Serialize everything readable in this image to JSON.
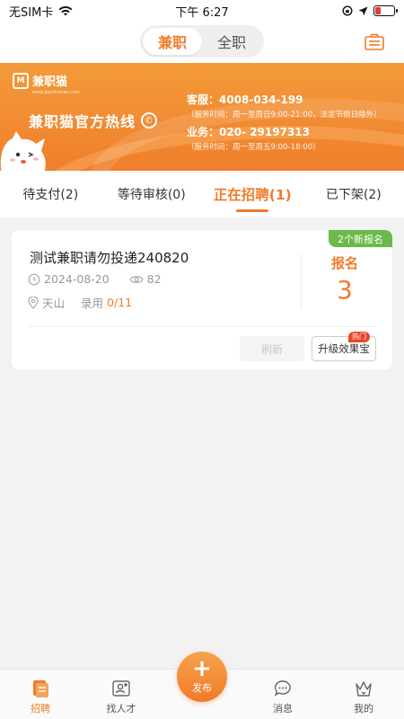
{
  "status_bar": {
    "carrier": "无SIM卡",
    "time": "下午 6:27",
    "battery_level": 0.3,
    "battery_color": "#e53935"
  },
  "header": {
    "segments": [
      {
        "label": "兼职",
        "active": true
      },
      {
        "label": "全职",
        "active": false
      }
    ],
    "right_icon": "briefcase-icon"
  },
  "banner": {
    "logo_text": "兼职猫",
    "logo_url": "www.jianzhimao.com",
    "hotline_title": "兼职猫官方热线",
    "service_line": "客服：4008-034-199",
    "service_hours": "（服务时间：周一至周日9:00-21:00，法定节假日除外）",
    "business_line": "业务：020- 29197313",
    "business_hours": "（服务时间：周一至周五9:00-18:00）"
  },
  "tabs": [
    {
      "label": "待支付(2)",
      "active": false
    },
    {
      "label": "等待审核(0)",
      "active": false
    },
    {
      "label": "正在招聘(1)",
      "active": true
    },
    {
      "label": "已下架(2)",
      "active": false
    }
  ],
  "job": {
    "title": "测试兼职请勿投递240820",
    "date": "2024-08-20",
    "views": "82",
    "location": "天山",
    "hire_label": "录用",
    "hire_value": "0/11",
    "new_badge": "2个新报名",
    "apply_label": "报名",
    "apply_count": "3",
    "refresh_label": "刷新",
    "upgrade_label": "升级效果宝",
    "hot_label": "热门"
  },
  "bottom_nav": {
    "items": [
      {
        "label": "招聘",
        "icon": "recruit-icon",
        "active": true
      },
      {
        "label": "找人才",
        "icon": "find-talent-icon",
        "active": false
      },
      {
        "label": "消息",
        "icon": "message-icon",
        "active": false
      },
      {
        "label": "我的",
        "icon": "profile-icon",
        "active": false
      }
    ],
    "publish_label": "发布"
  },
  "colors": {
    "accent": "#f07b2a",
    "new_badge": "#6ab94a",
    "hot_badge": "#e8452c"
  }
}
